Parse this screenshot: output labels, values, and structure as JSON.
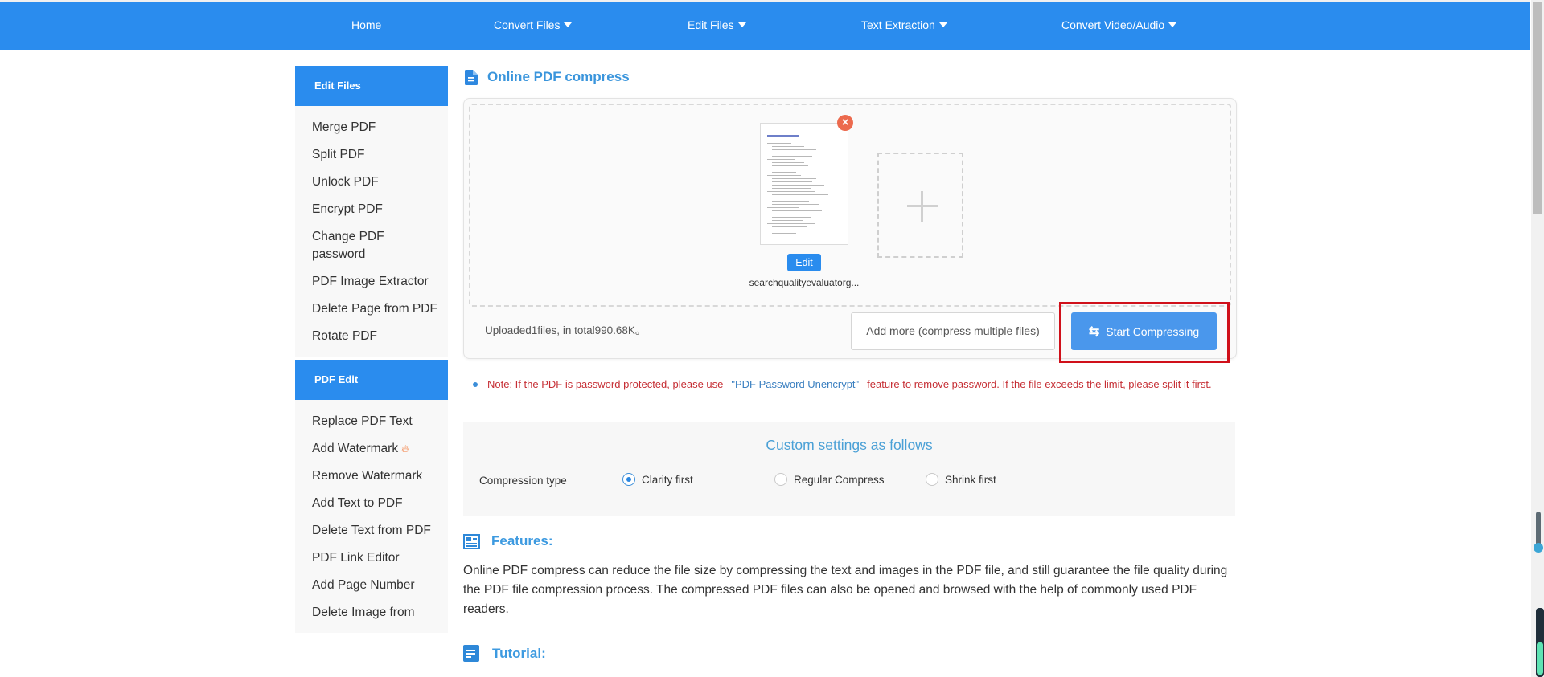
{
  "nav": {
    "items": [
      {
        "label": "Home",
        "has_dropdown": false
      },
      {
        "label": "Convert Files",
        "has_dropdown": true
      },
      {
        "label": "Edit Files",
        "has_dropdown": true
      },
      {
        "label": "Text Extraction",
        "has_dropdown": true
      },
      {
        "label": "Convert Video/Audio",
        "has_dropdown": true
      }
    ]
  },
  "sidebar": {
    "sections": [
      {
        "title": "Edit Files",
        "items": [
          "Merge PDF",
          "Split PDF",
          "Unlock PDF",
          "Encrypt PDF",
          "Change PDF password",
          "PDF Image Extractor",
          "Delete Page from PDF",
          "Rotate PDF"
        ]
      },
      {
        "title": "PDF Edit",
        "items": [
          "Replace PDF Text",
          "Add Watermark",
          "Remove Watermark",
          "Add Text to PDF",
          "Delete Text from PDF",
          "PDF Link Editor",
          "Add Page Number",
          "Delete Image from"
        ]
      }
    ],
    "hot_item_icon": "fire-icon"
  },
  "main": {
    "title": "Online PDF compress",
    "upload": {
      "file_name": "searchqualityevaluatorg...",
      "edit_label": "Edit",
      "remove_icon": "close-icon",
      "add_icon": "plus-icon",
      "status": "Uploaded1files, in total990.68K。",
      "add_more_label": "Add more (compress multiple files)",
      "start_label": "Start Compressing",
      "start_icon": "swap-arrows-icon"
    },
    "note": {
      "prefix": "Note: If the PDF is password protected, please use",
      "link": "\"PDF Password Unencrypt\"",
      "suffix": "feature to remove password. If the file exceeds the limit, please split it first."
    },
    "settings": {
      "title": "Custom settings as follows",
      "compression_label": "Compression type",
      "options": [
        {
          "label": "Clarity first",
          "selected": true
        },
        {
          "label": "Regular Compress",
          "selected": false
        },
        {
          "label": "Shrink first",
          "selected": false
        }
      ]
    },
    "features": {
      "heading": "Features:",
      "text": "Online PDF compress can reduce the file size by compressing the text and images in the PDF file, and still guarantee the file quality during the PDF file compression process. The compressed PDF files can also be opened and browsed with the help of commonly used PDF readers."
    },
    "tutorial": {
      "heading": "Tutorial:"
    }
  },
  "colors": {
    "brand_blue": "#2a8cee",
    "button_blue": "#4a97ec",
    "note_red": "#c62f35",
    "highlight_red": "#d0101a",
    "heading_blue": "#3a95dc"
  }
}
